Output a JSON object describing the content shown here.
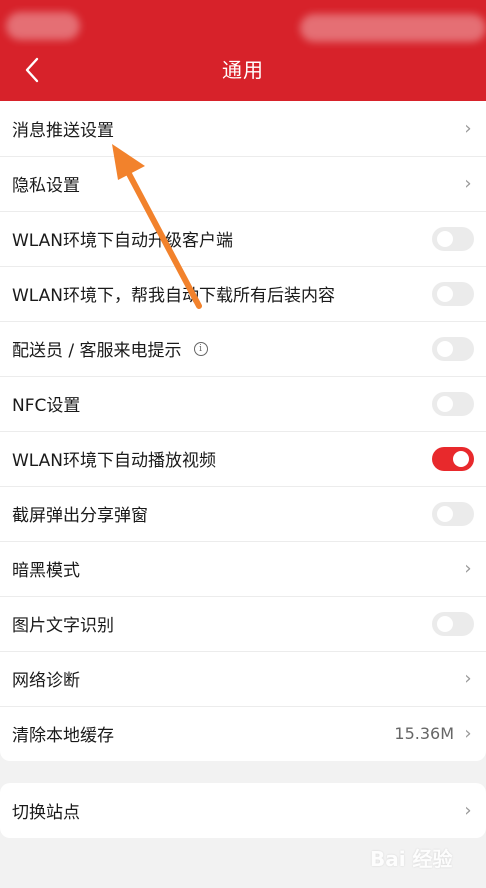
{
  "header": {
    "title": "通用",
    "background": "#d7222a"
  },
  "settings": {
    "items": [
      {
        "label": "消息推送设置",
        "control": "chevron"
      },
      {
        "label": "隐私设置",
        "control": "chevron"
      },
      {
        "label": "WLAN环境下自动升级客户端",
        "control": "toggle",
        "on": false
      },
      {
        "label": "WLAN环境下，帮我自动下载所有后装内容",
        "control": "toggle",
        "on": false
      },
      {
        "label": "配送员 / 客服来电提示",
        "control": "toggle",
        "on": false,
        "info_icon": "ⓘ"
      },
      {
        "label": "NFC设置",
        "control": "toggle",
        "on": false
      },
      {
        "label": "WLAN环境下自动播放视频",
        "control": "toggle",
        "on": true
      },
      {
        "label": "截屏弹出分享弹窗",
        "control": "toggle",
        "on": false
      },
      {
        "label": "暗黑模式",
        "control": "chevron"
      },
      {
        "label": "图片文字识别",
        "control": "toggle",
        "on": false
      },
      {
        "label": "网络诊断",
        "control": "chevron"
      },
      {
        "label": "清除本地缓存",
        "control": "chevron",
        "value": "15.36M"
      }
    ]
  },
  "site": {
    "label": "切换站点"
  },
  "glyphs": {
    "chevron": "›",
    "info": "i"
  },
  "watermark": {
    "text": "Bai 经验"
  },
  "colors": {
    "toggle_on": "#e8292c",
    "toggle_off": "#ebebeb",
    "annotation_arrow": "#f2822c"
  }
}
